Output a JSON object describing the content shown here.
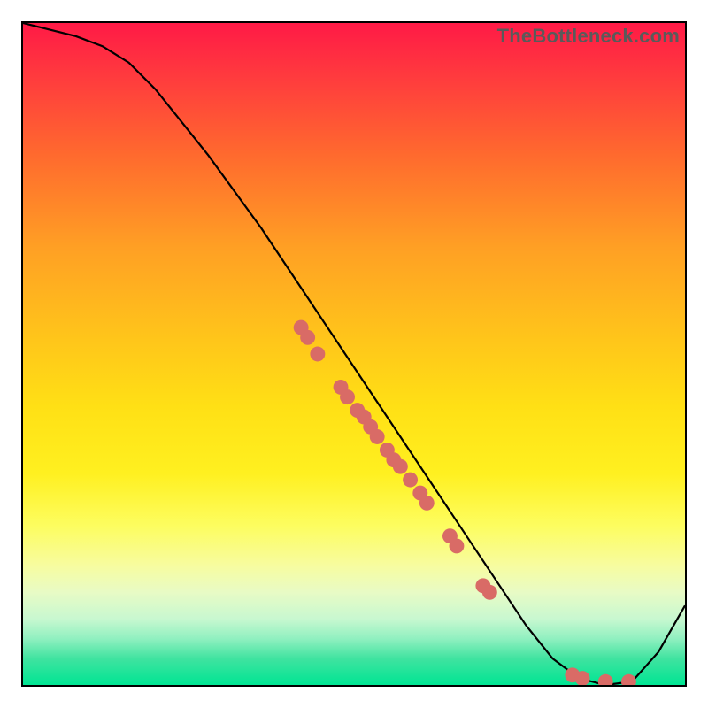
{
  "watermark": "TheBottleneck.com",
  "chart_data": {
    "type": "line",
    "title": "",
    "xlabel": "",
    "ylabel": "",
    "xlim": [
      0,
      100
    ],
    "ylim": [
      0,
      100
    ],
    "grid": false,
    "series": [
      {
        "name": "curve",
        "x": [
          0,
          4,
          8,
          12,
          16,
          20,
          24,
          28,
          32,
          36,
          40,
          44,
          48,
          52,
          56,
          60,
          64,
          68,
          72,
          76,
          80,
          84,
          88,
          92,
          96,
          100
        ],
        "y": [
          100,
          99,
          98,
          96.5,
          94,
          90,
          85,
          80,
          74.5,
          69,
          63,
          57,
          51,
          45,
          39,
          33,
          27,
          21,
          15,
          9,
          4,
          1,
          0,
          0.5,
          5,
          12
        ]
      }
    ],
    "scatter": [
      {
        "name": "points-on-curve",
        "color": "#d96b66",
        "points": [
          {
            "x": 42,
            "y": 54
          },
          {
            "x": 43,
            "y": 52.5
          },
          {
            "x": 44.5,
            "y": 50
          },
          {
            "x": 48,
            "y": 45
          },
          {
            "x": 49,
            "y": 43.5
          },
          {
            "x": 50.5,
            "y": 41.5
          },
          {
            "x": 51.5,
            "y": 40.5
          },
          {
            "x": 52.5,
            "y": 39
          },
          {
            "x": 53.5,
            "y": 37.5
          },
          {
            "x": 55,
            "y": 35.5
          },
          {
            "x": 56,
            "y": 34
          },
          {
            "x": 57,
            "y": 33
          },
          {
            "x": 58.5,
            "y": 31
          },
          {
            "x": 60,
            "y": 29
          },
          {
            "x": 61,
            "y": 27.5
          },
          {
            "x": 64.5,
            "y": 22.5
          },
          {
            "x": 65.5,
            "y": 21
          },
          {
            "x": 69.5,
            "y": 15
          },
          {
            "x": 70.5,
            "y": 14
          },
          {
            "x": 83,
            "y": 1.5
          },
          {
            "x": 84.5,
            "y": 1
          },
          {
            "x": 88,
            "y": 0.5
          },
          {
            "x": 91.5,
            "y": 0.5
          }
        ]
      }
    ]
  }
}
